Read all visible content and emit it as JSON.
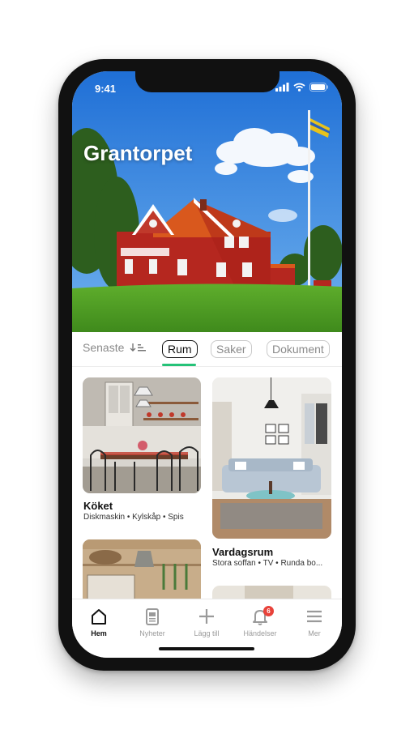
{
  "status_bar": {
    "time": "9:41"
  },
  "header": {
    "title": "Grantorpet"
  },
  "tabs": [
    {
      "label": "Senaste",
      "active": false
    },
    {
      "label": "Rum",
      "active": true
    },
    {
      "label": "Saker",
      "active": false
    },
    {
      "label": "Dokument",
      "active": false
    }
  ],
  "rooms": [
    {
      "title": "Köket",
      "subtitle": "Diskmaskin • Kylskåp • Spis"
    },
    {
      "title": "Vardagsrum",
      "subtitle": "Stora soffan • TV • Runda bo..."
    }
  ],
  "nav": [
    {
      "label": "Hem",
      "icon": "home-icon",
      "active": true
    },
    {
      "label": "Nyheter",
      "icon": "news-icon",
      "active": false
    },
    {
      "label": "Lägg till",
      "icon": "plus-icon",
      "active": false
    },
    {
      "label": "Händelser",
      "icon": "bell-icon",
      "active": false,
      "badge": "6"
    },
    {
      "label": "Mer",
      "icon": "menu-icon",
      "active": false
    }
  ],
  "colors": {
    "accent": "#25c278",
    "badge": "#e8423a"
  }
}
